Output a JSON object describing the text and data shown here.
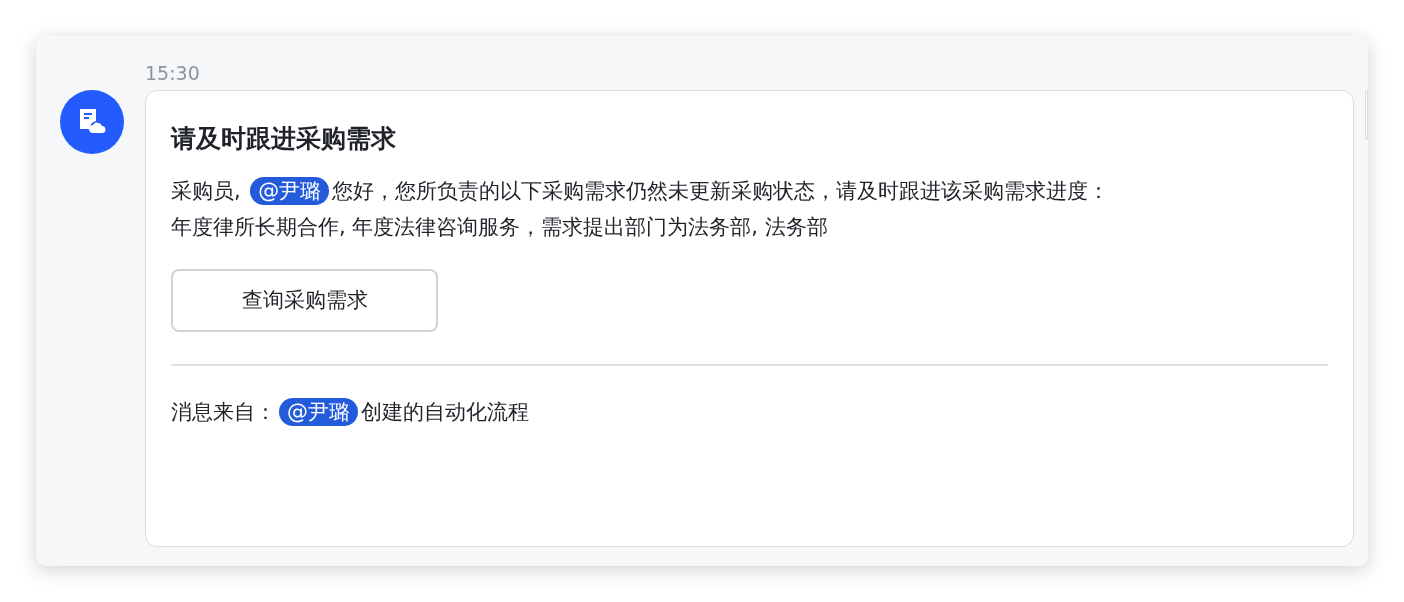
{
  "message": {
    "time": "15:30",
    "card": {
      "title": "请及时跟进采购需求",
      "body": [
        {
          "kind": "text",
          "text": "采购员, "
        },
        {
          "kind": "mention",
          "text": "@尹璐"
        },
        {
          "kind": "text",
          "text": "您好，您所负责的以下采购需求仍然未更新采购状态，请及时跟进该采购需求进度："
        }
      ],
      "detail": "年度律所长期合作, 年度法律咨询服务，需求提出部门为法务部, 法务部",
      "button": "查询采购需求",
      "footer": [
        {
          "kind": "text",
          "text": "消息来自："
        },
        {
          "kind": "mention",
          "text": "@尹璐"
        },
        {
          "kind": "text",
          "text": "创建的自动化流程"
        }
      ]
    }
  }
}
